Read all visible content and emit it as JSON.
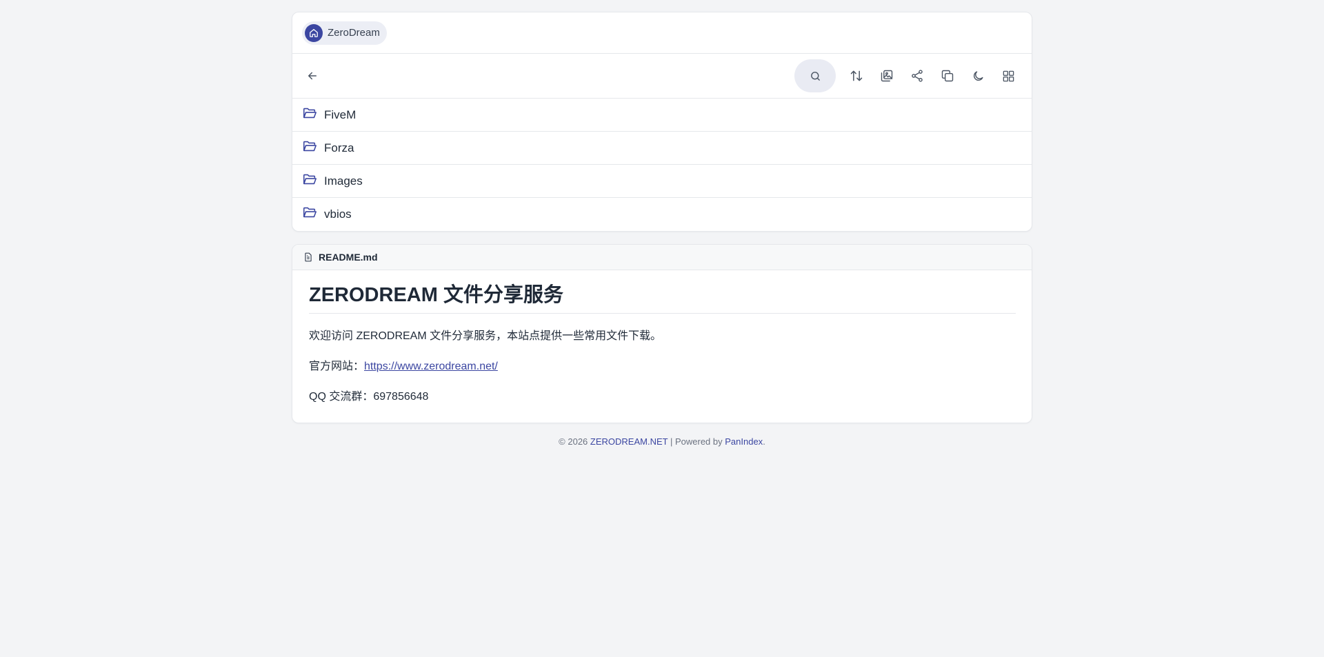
{
  "breadcrumb": {
    "home_label": "ZeroDream"
  },
  "toolbar": {
    "icons": [
      "back-arrow-icon",
      "search-icon",
      "sort-icon",
      "gallery-icon",
      "share-icon",
      "copy-icon",
      "moon-icon",
      "grid-icon"
    ]
  },
  "folders": [
    {
      "name": "FiveM"
    },
    {
      "name": "Forza"
    },
    {
      "name": "Images"
    },
    {
      "name": "vbios"
    }
  ],
  "readme": {
    "filename": "README.md",
    "title": "ZERODREAM 文件分享服务",
    "intro": "欢迎访问 ZERODREAM 文件分享服务，本站点提供一些常用文件下载。",
    "site_label": "官方网站：",
    "site_url": "https://www.zerodream.net/",
    "qq_label": "QQ 交流群：",
    "qq_number": "697856648"
  },
  "footer": {
    "copyright": "© 2026",
    "brand": "ZERODREAM.NET",
    "separator": "| Powered by",
    "powered": "PanIndex",
    "end": "."
  },
  "colors": {
    "accent": "#3b46a1",
    "background": "#f3f4f6",
    "card": "#ffffff",
    "border": "#e5e7eb"
  }
}
